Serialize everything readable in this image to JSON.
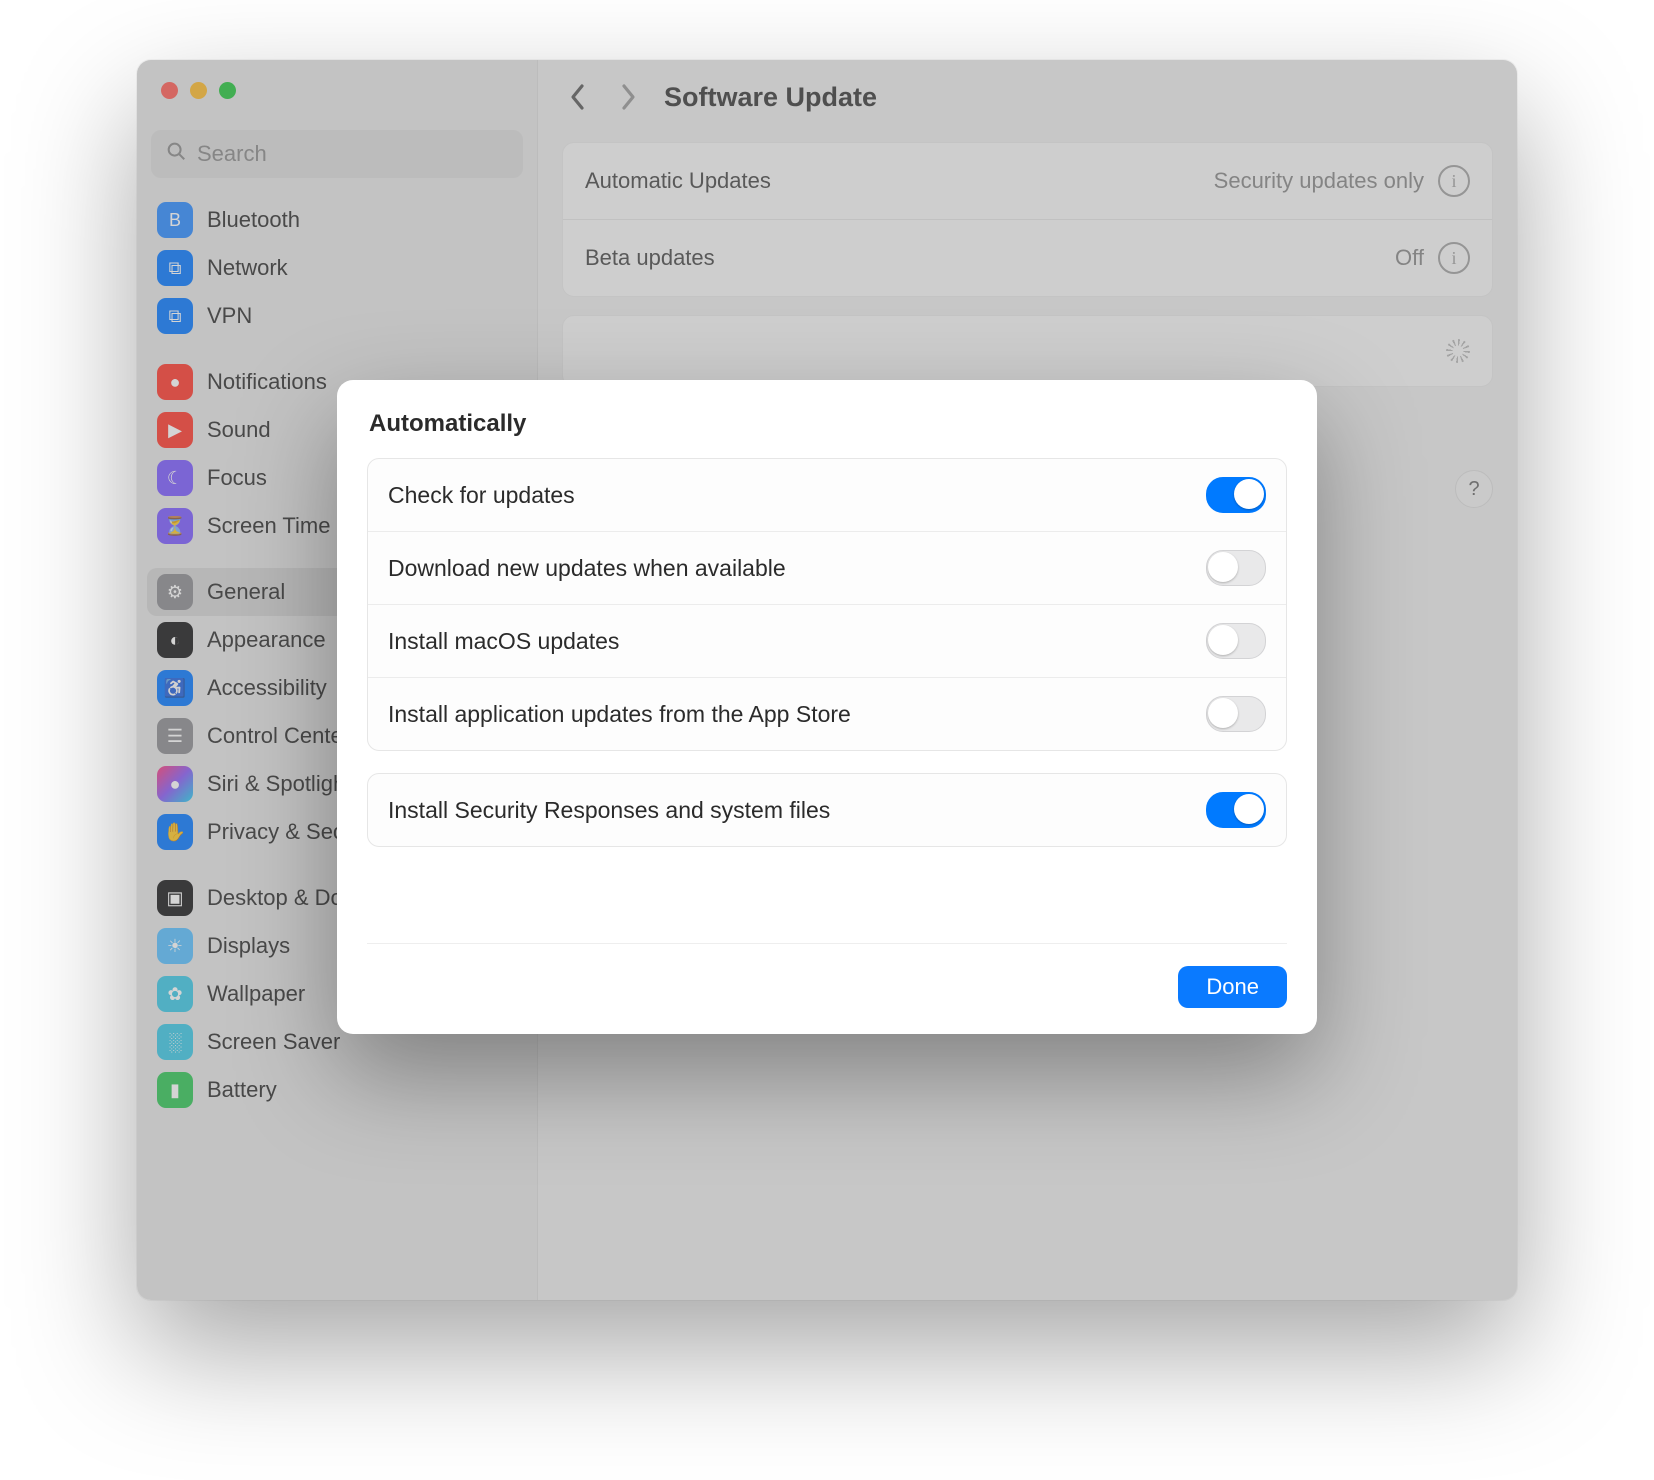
{
  "window": {
    "title": "Software Update"
  },
  "search": {
    "placeholder": "Search"
  },
  "sidebar": {
    "groups": [
      [
        {
          "id": "bluetooth",
          "label": "Bluetooth",
          "iconClass": "bg-blue",
          "glyph": "B"
        },
        {
          "id": "network",
          "label": "Network",
          "iconClass": "bg-blue2",
          "glyph": "⧉"
        },
        {
          "id": "vpn",
          "label": "VPN",
          "iconClass": "bg-blue2",
          "glyph": "⧉"
        }
      ],
      [
        {
          "id": "notifications",
          "label": "Notifications",
          "iconClass": "bg-red",
          "glyph": "●"
        },
        {
          "id": "sound",
          "label": "Sound",
          "iconClass": "bg-red",
          "glyph": "▶"
        },
        {
          "id": "focus",
          "label": "Focus",
          "iconClass": "bg-purple",
          "glyph": "☾"
        },
        {
          "id": "screen-time",
          "label": "Screen Time",
          "iconClass": "bg-purple",
          "glyph": "⏳"
        }
      ],
      [
        {
          "id": "general",
          "label": "General",
          "iconClass": "bg-gray",
          "glyph": "⚙",
          "selected": true
        },
        {
          "id": "appearance",
          "label": "Appearance",
          "iconClass": "bg-dark",
          "glyph": "◐"
        },
        {
          "id": "accessibility",
          "label": "Accessibility",
          "iconClass": "bg-blue2",
          "glyph": "♿"
        },
        {
          "id": "control-center",
          "label": "Control Center",
          "iconClass": "bg-gray",
          "glyph": "☰"
        },
        {
          "id": "siri",
          "label": "Siri & Spotlight",
          "iconClass": "bg-grad",
          "glyph": "●"
        },
        {
          "id": "privacy",
          "label": "Privacy & Security",
          "iconClass": "bg-blue2",
          "glyph": "✋"
        }
      ],
      [
        {
          "id": "desktop-dock",
          "label": "Desktop & Dock",
          "iconClass": "bg-dark",
          "glyph": "▣"
        },
        {
          "id": "displays",
          "label": "Displays",
          "iconClass": "bg-lblue",
          "glyph": "☀"
        },
        {
          "id": "wallpaper",
          "label": "Wallpaper",
          "iconClass": "bg-cyan",
          "glyph": "✿"
        },
        {
          "id": "screen-saver",
          "label": "Screen Saver",
          "iconClass": "bg-cyan",
          "glyph": "░"
        },
        {
          "id": "battery",
          "label": "Battery",
          "iconClass": "bg-green",
          "glyph": "▮"
        }
      ]
    ]
  },
  "main": {
    "rows": {
      "auto_updates_label": "Automatic Updates",
      "auto_updates_value": "Security updates only",
      "beta_label": "Beta updates",
      "beta_value": "Off"
    }
  },
  "sheet": {
    "title": "Automatically",
    "settings": {
      "check": {
        "label": "Check for updates",
        "on": true
      },
      "download": {
        "label": "Download new updates when available",
        "on": false
      },
      "install_macos": {
        "label": "Install macOS updates",
        "on": false
      },
      "install_apps": {
        "label": "Install application updates from the App Store",
        "on": false
      },
      "install_security": {
        "label": "Install Security Responses and system files",
        "on": true
      }
    },
    "done": "Done"
  },
  "help_glyph": "?"
}
